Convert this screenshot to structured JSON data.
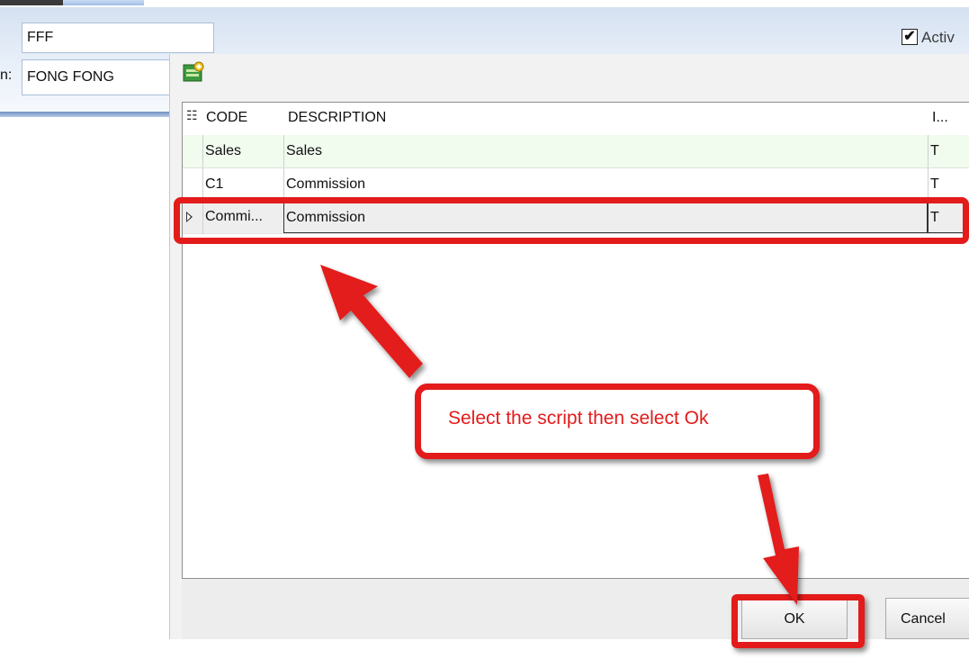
{
  "form": {
    "code_value": "FFF",
    "description_label_fragment": "n:",
    "description_value": "FONG FONG",
    "active_label": "Activ",
    "active_checked": true
  },
  "dialog": {
    "toolbar_icon": "script-icon",
    "grid": {
      "headers": {
        "code": "CODE",
        "description": "DESCRIPTION",
        "i": "I..."
      },
      "rows": [
        {
          "code": "Sales",
          "description": "Sales",
          "i": "T",
          "state": "new-row"
        },
        {
          "code": "C1",
          "description": "Commission",
          "i": "T",
          "state": "normal"
        },
        {
          "code": "Commi...",
          "description": "Commission",
          "i": "T",
          "state": "selected"
        }
      ]
    },
    "buttons": {
      "ok": "OK",
      "cancel": "Cancel"
    }
  },
  "annotation": {
    "callout_text": "Select the script then select Ok",
    "color": "#e31b1b"
  }
}
